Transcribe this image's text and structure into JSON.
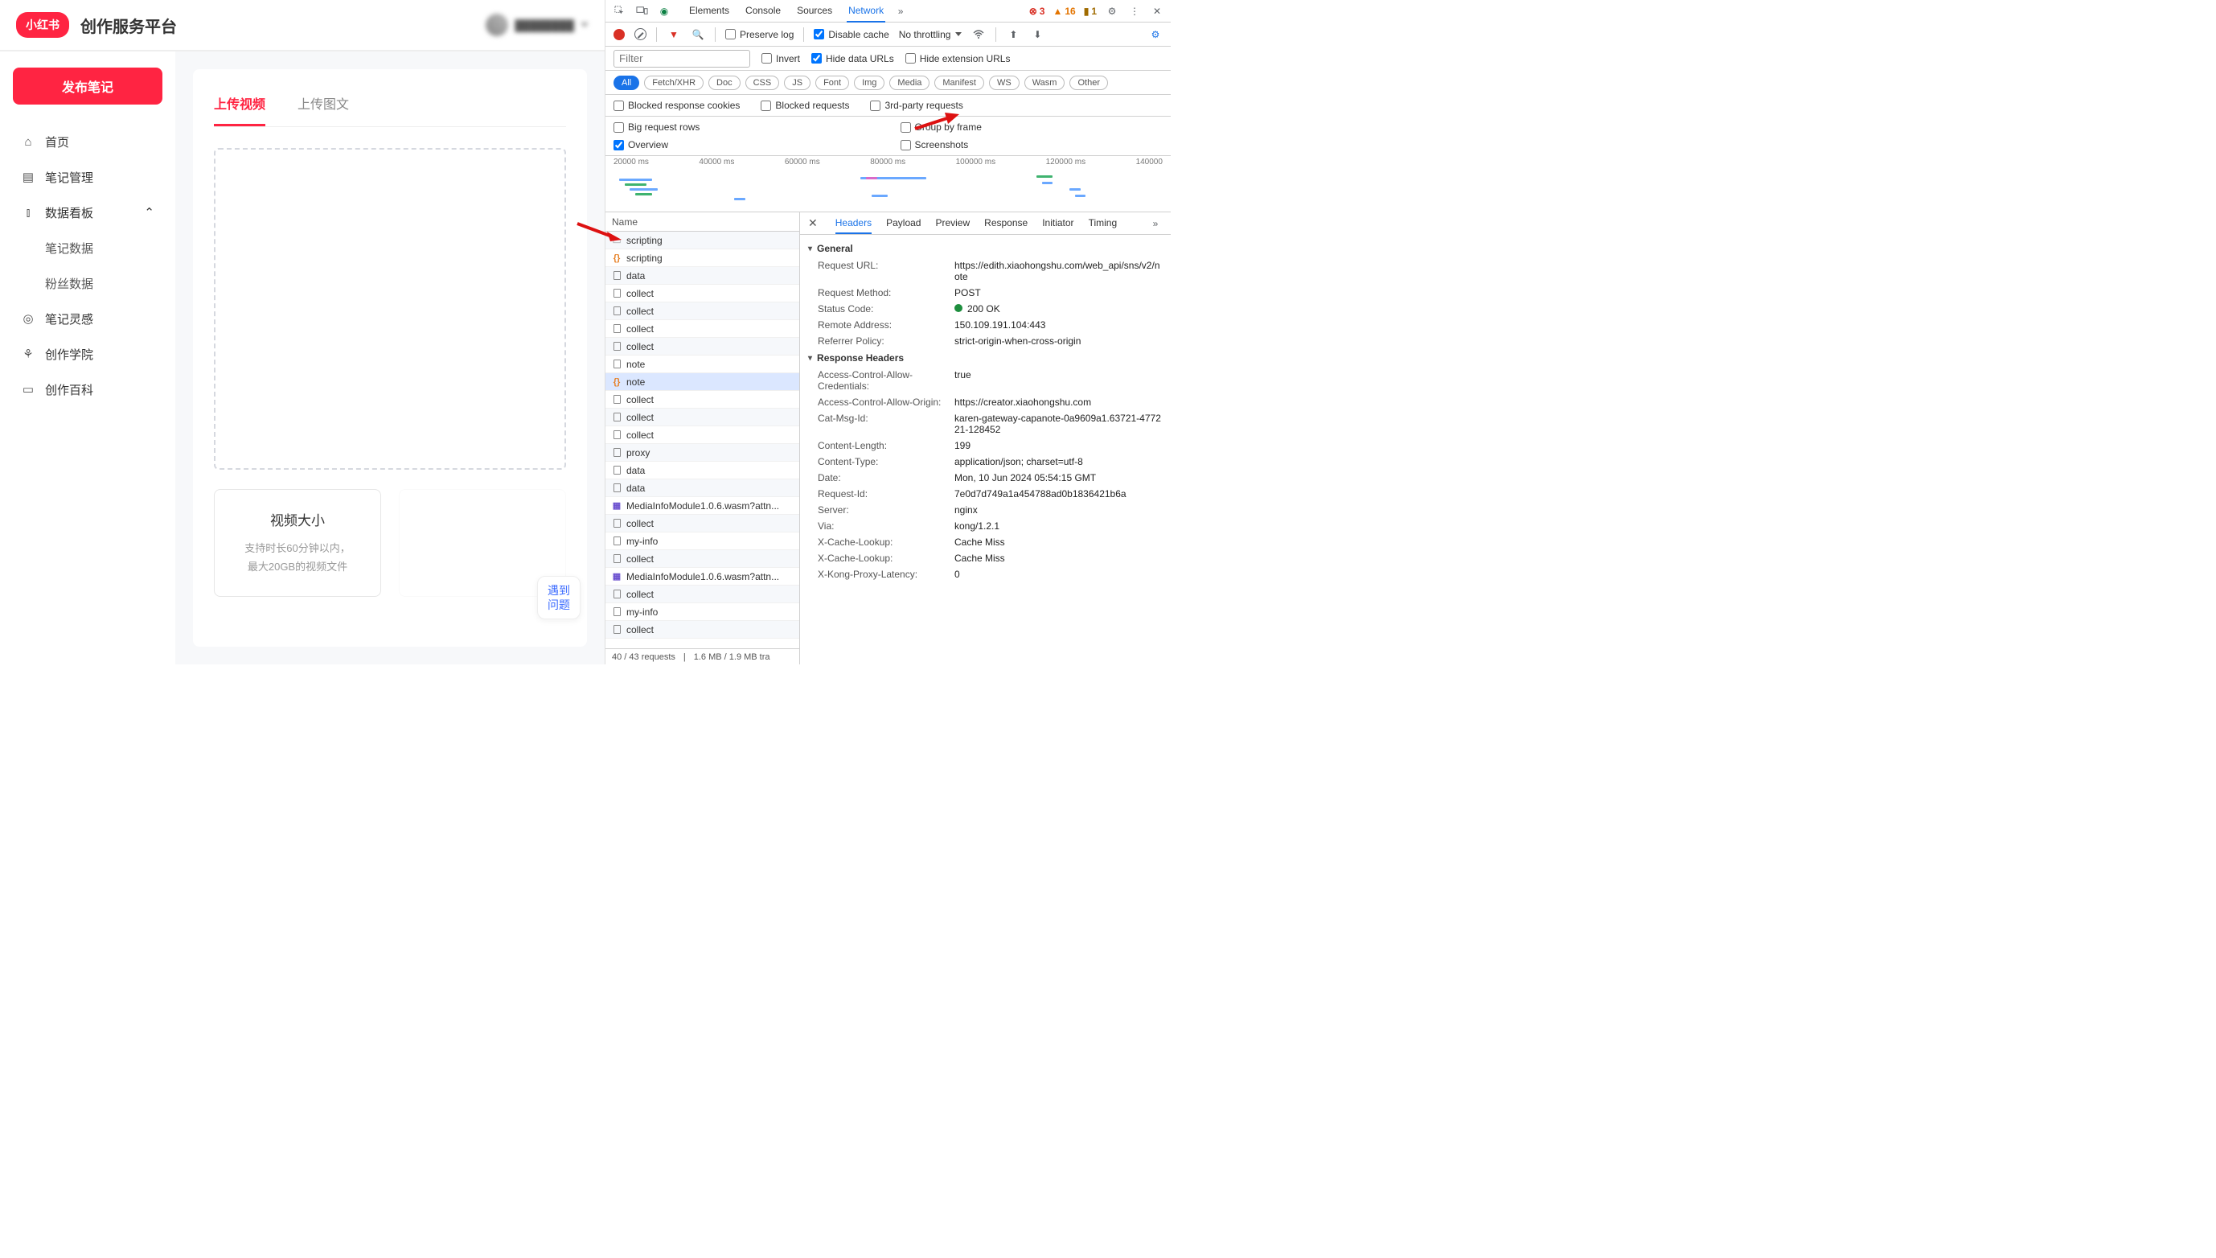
{
  "app": {
    "logo": "小红书",
    "title": "创作服务平台",
    "user_name": "████████"
  },
  "sidebar": {
    "publish": "发布笔记",
    "items": [
      {
        "icon": "home",
        "label": "首页"
      },
      {
        "icon": "note",
        "label": "笔记管理"
      },
      {
        "icon": "chart",
        "label": "数据看板",
        "expanded": true
      },
      {
        "icon": "",
        "label": "笔记数据",
        "sub": true
      },
      {
        "icon": "",
        "label": "粉丝数据",
        "sub": true
      },
      {
        "icon": "bulb",
        "label": "笔记灵感"
      },
      {
        "icon": "grad",
        "label": "创作学院"
      },
      {
        "icon": "book",
        "label": "创作百科"
      }
    ]
  },
  "content": {
    "tabs": [
      "上传视频",
      "上传图文"
    ],
    "active_tab": 0,
    "info_card": {
      "title": "视频大小",
      "line1": "支持时长60分钟以内，",
      "line2": "最大20GB的视频文件"
    },
    "feedback": "遇到\n问题"
  },
  "devtools": {
    "top_tabs": [
      "Elements",
      "Console",
      "Sources",
      "Network"
    ],
    "active_top_tab": 3,
    "badges": {
      "errors": 3,
      "warnings": 16,
      "info": 1
    },
    "toolbar": {
      "preserve_log": "Preserve log",
      "disable_cache": "Disable cache",
      "throttling": "No throttling"
    },
    "filter": {
      "placeholder": "Filter",
      "invert": "Invert",
      "hide_data_urls": "Hide data URLs",
      "hide_ext_urls": "Hide extension URLs"
    },
    "types": [
      "All",
      "Fetch/XHR",
      "Doc",
      "CSS",
      "JS",
      "Font",
      "Img",
      "Media",
      "Manifest",
      "WS",
      "Wasm",
      "Other"
    ],
    "opts": {
      "blocked_cookies": "Blocked response cookies",
      "blocked_req": "Blocked requests",
      "third_party": "3rd-party requests",
      "big_rows": "Big request rows",
      "group_frame": "Group by frame",
      "overview": "Overview",
      "screenshots": "Screenshots"
    },
    "timeline_ticks": [
      "20000 ms",
      "40000 ms",
      "60000 ms",
      "80000 ms",
      "100000 ms",
      "120000 ms",
      "140000"
    ],
    "name_header": "Name",
    "requests": [
      {
        "name": "scripting",
        "type": "text",
        "cut": true
      },
      {
        "name": "scripting",
        "type": "js"
      },
      {
        "name": "data",
        "type": "file"
      },
      {
        "name": "collect",
        "type": "file"
      },
      {
        "name": "collect",
        "type": "file"
      },
      {
        "name": "collect",
        "type": "file"
      },
      {
        "name": "collect",
        "type": "file"
      },
      {
        "name": "note",
        "type": "file"
      },
      {
        "name": "note",
        "type": "js",
        "selected": true
      },
      {
        "name": "collect",
        "type": "file"
      },
      {
        "name": "collect",
        "type": "file"
      },
      {
        "name": "collect",
        "type": "file"
      },
      {
        "name": "proxy",
        "type": "file"
      },
      {
        "name": "data",
        "type": "file"
      },
      {
        "name": "data",
        "type": "file"
      },
      {
        "name": "MediaInfoModule1.0.6.wasm?attn...",
        "type": "wasm"
      },
      {
        "name": "collect",
        "type": "file"
      },
      {
        "name": "my-info",
        "type": "file"
      },
      {
        "name": "collect",
        "type": "file"
      },
      {
        "name": "MediaInfoModule1.0.6.wasm?attn...",
        "type": "wasm"
      },
      {
        "name": "collect",
        "type": "file"
      },
      {
        "name": "my-info",
        "type": "file"
      },
      {
        "name": "collect",
        "type": "file"
      }
    ],
    "status_bar": {
      "reqs": "40 / 43 requests",
      "transfer": "1.6 MB / 1.9 MB tra"
    },
    "detail_tabs": [
      "Headers",
      "Payload",
      "Preview",
      "Response",
      "Initiator",
      "Timing"
    ],
    "active_detail_tab": 0,
    "general_label": "General",
    "general": [
      {
        "k": "Request URL:",
        "v": "https://edith.xiaohongshu.com/web_api/sns/v2/note"
      },
      {
        "k": "Request Method:",
        "v": "POST"
      },
      {
        "k": "Status Code:",
        "v": "200 OK",
        "status": true
      },
      {
        "k": "Remote Address:",
        "v": "150.109.191.104:443"
      },
      {
        "k": "Referrer Policy:",
        "v": "strict-origin-when-cross-origin"
      }
    ],
    "response_headers_label": "Response Headers",
    "response_headers": [
      {
        "k": "Access-Control-Allow-Credentials:",
        "v": "true"
      },
      {
        "k": "Access-Control-Allow-Origin:",
        "v": "https://creator.xiaohongshu.com"
      },
      {
        "k": "Cat-Msg-Id:",
        "v": "karen-gateway-capanote-0a9609a1.63721-477221-128452"
      },
      {
        "k": "Content-Length:",
        "v": "199"
      },
      {
        "k": "Content-Type:",
        "v": "application/json; charset=utf-8"
      },
      {
        "k": "Date:",
        "v": "Mon, 10 Jun 2024 05:54:15 GMT"
      },
      {
        "k": "Request-Id:",
        "v": "7e0d7d749a1a454788ad0b1836421b6a"
      },
      {
        "k": "Server:",
        "v": "nginx"
      },
      {
        "k": "Via:",
        "v": "kong/1.2.1"
      },
      {
        "k": "X-Cache-Lookup:",
        "v": "Cache Miss"
      },
      {
        "k": "X-Cache-Lookup:",
        "v": "Cache Miss"
      },
      {
        "k": "X-Kong-Proxy-Latency:",
        "v": "0"
      }
    ]
  }
}
